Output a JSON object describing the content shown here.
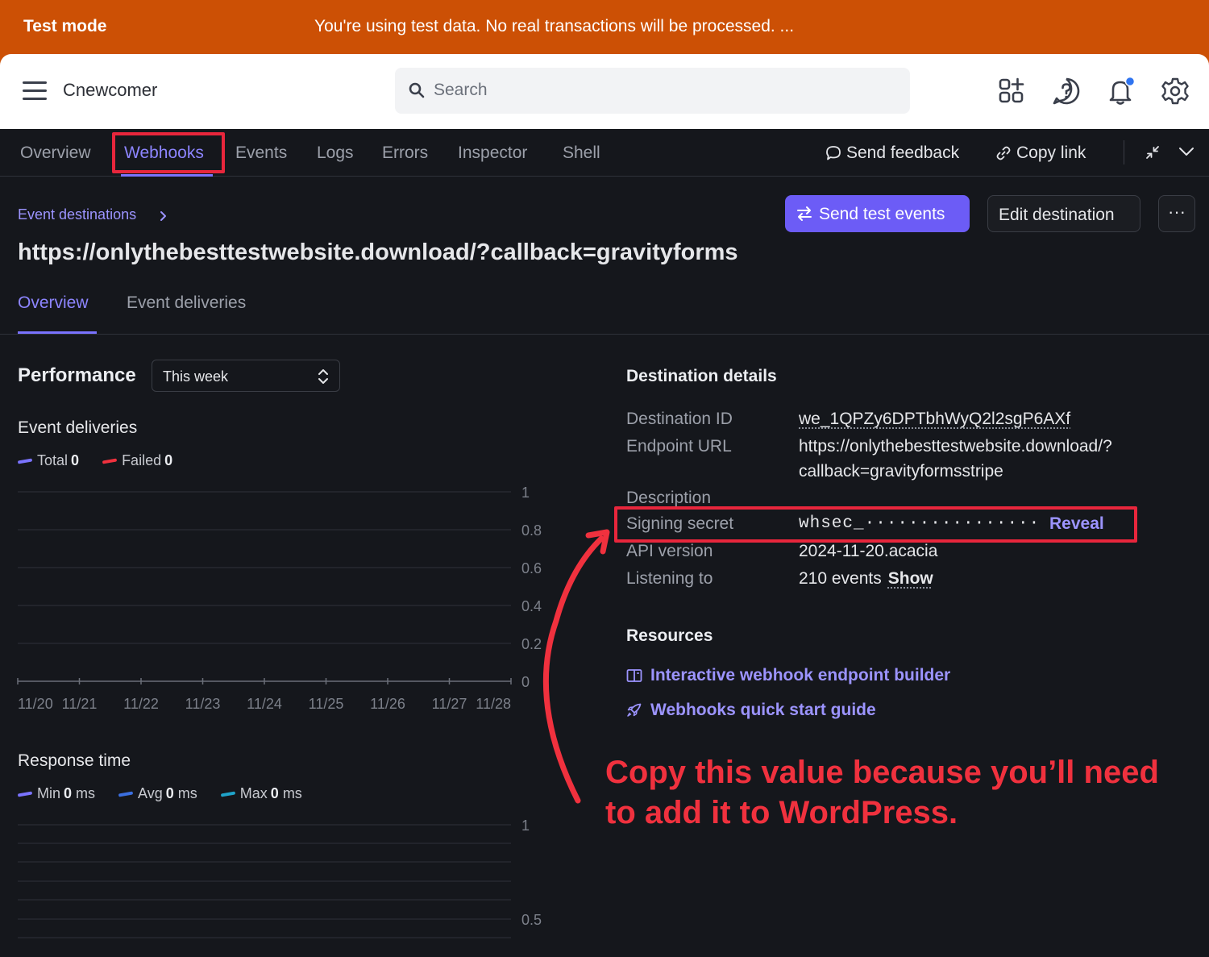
{
  "banner": {
    "mode": "Test mode",
    "text": "You're using test data. No real transactions will be processed. ..."
  },
  "header": {
    "account": "Cnewcomer",
    "search_placeholder": "Search"
  },
  "devtools": {
    "tabs": [
      "Overview",
      "Webhooks",
      "Events",
      "Logs",
      "Errors",
      "Inspector",
      "Shell"
    ],
    "active_tab": "Webhooks",
    "send_feedback": "Send feedback",
    "copy_link": "Copy link"
  },
  "destination": {
    "breadcrumb": "Event destinations",
    "title": "https://onlythebesttestwebsite.download/?callback=gravityforms",
    "send_test_events": "Send test events",
    "edit_destination": "Edit destination",
    "more": "···",
    "tabs": [
      "Overview",
      "Event deliveries"
    ]
  },
  "performance": {
    "title": "Performance",
    "range": "This week",
    "deliveries": {
      "title": "Event deliveries",
      "total_label": "Total",
      "total": "0",
      "failed_label": "Failed",
      "failed": "0"
    },
    "response": {
      "title": "Response time",
      "min_label": "Min",
      "min": "0",
      "avg_label": "Avg",
      "avg": "0",
      "max_label": "Max",
      "max": "0",
      "unit": "ms"
    }
  },
  "chart_data": [
    {
      "type": "line",
      "title": "Event deliveries",
      "x": [
        "11/20",
        "11/21",
        "11/22",
        "11/23",
        "11/24",
        "11/25",
        "11/26",
        "11/27",
        "11/28"
      ],
      "series": [
        {
          "name": "Total",
          "values": [
            0,
            0,
            0,
            0,
            0,
            0,
            0,
            0,
            0
          ],
          "color": "#7a73ff"
        },
        {
          "name": "Failed",
          "values": [
            0,
            0,
            0,
            0,
            0,
            0,
            0,
            0,
            0
          ],
          "color": "#f0313e"
        }
      ],
      "ylim": [
        0,
        1
      ],
      "yticks": [
        "1",
        "0.8",
        "0.6",
        "0.4",
        "0.2",
        "0"
      ],
      "grid": true,
      "legend": "top-left"
    },
    {
      "type": "line",
      "title": "Response time",
      "series": [
        {
          "name": "Min",
          "color": "#7a73ff"
        },
        {
          "name": "Avg",
          "color": "#3b6fe0"
        },
        {
          "name": "Max",
          "color": "#1fa3c9"
        }
      ],
      "yticks": [
        "1",
        "0.5"
      ],
      "grid": true,
      "legend": "top-left"
    }
  ],
  "details": {
    "title": "Destination details",
    "destination_id_label": "Destination ID",
    "destination_id": "we_1QPZy6DPTbhWyQ2l2sgP6AXf",
    "endpoint_url_label": "Endpoint URL",
    "endpoint_url_line1": "https://onlythebesttestwebsite.download/?",
    "endpoint_url_line2": "callback=gravityformsstripe",
    "description_label": "Description",
    "signing_secret_label": "Signing secret",
    "signing_secret": "whsec_················",
    "reveal": "Reveal",
    "api_version_label": "API version",
    "api_version": "2024-11-20.acacia",
    "listening_label": "Listening to",
    "listening": "210 events",
    "show": "Show"
  },
  "resources": {
    "title": "Resources",
    "builder": "Interactive webhook endpoint builder",
    "guide": "Webhooks quick start guide"
  },
  "annotation": "Copy this value because you’ll need to add it to WordPress.",
  "colors": {
    "banner": "#cc5005",
    "accent": "#6c5cf6",
    "link": "#9c94ff",
    "annotation": "#f0313e"
  }
}
